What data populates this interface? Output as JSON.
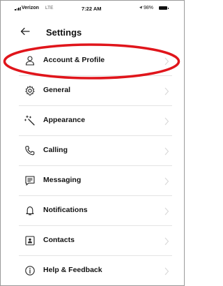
{
  "status_bar": {
    "carrier": "Verizon",
    "network": "LTE",
    "time": "7:22 AM",
    "location_icon": "location-arrow-icon",
    "battery_percent": "98%"
  },
  "header": {
    "back_icon": "arrow-left-icon",
    "title": "Settings"
  },
  "settings": {
    "items": [
      {
        "label": "Account & Profile",
        "icon": "person-icon"
      },
      {
        "label": "General",
        "icon": "gear-icon"
      },
      {
        "label": "Appearance",
        "icon": "magic-wand-icon"
      },
      {
        "label": "Calling",
        "icon": "phone-icon"
      },
      {
        "label": "Messaging",
        "icon": "message-icon"
      },
      {
        "label": "Notifications",
        "icon": "bell-icon"
      },
      {
        "label": "Contacts",
        "icon": "contact-card-icon"
      },
      {
        "label": "Help & Feedback",
        "icon": "info-icon"
      }
    ]
  },
  "annotation": {
    "highlight_color": "#e0151b"
  }
}
